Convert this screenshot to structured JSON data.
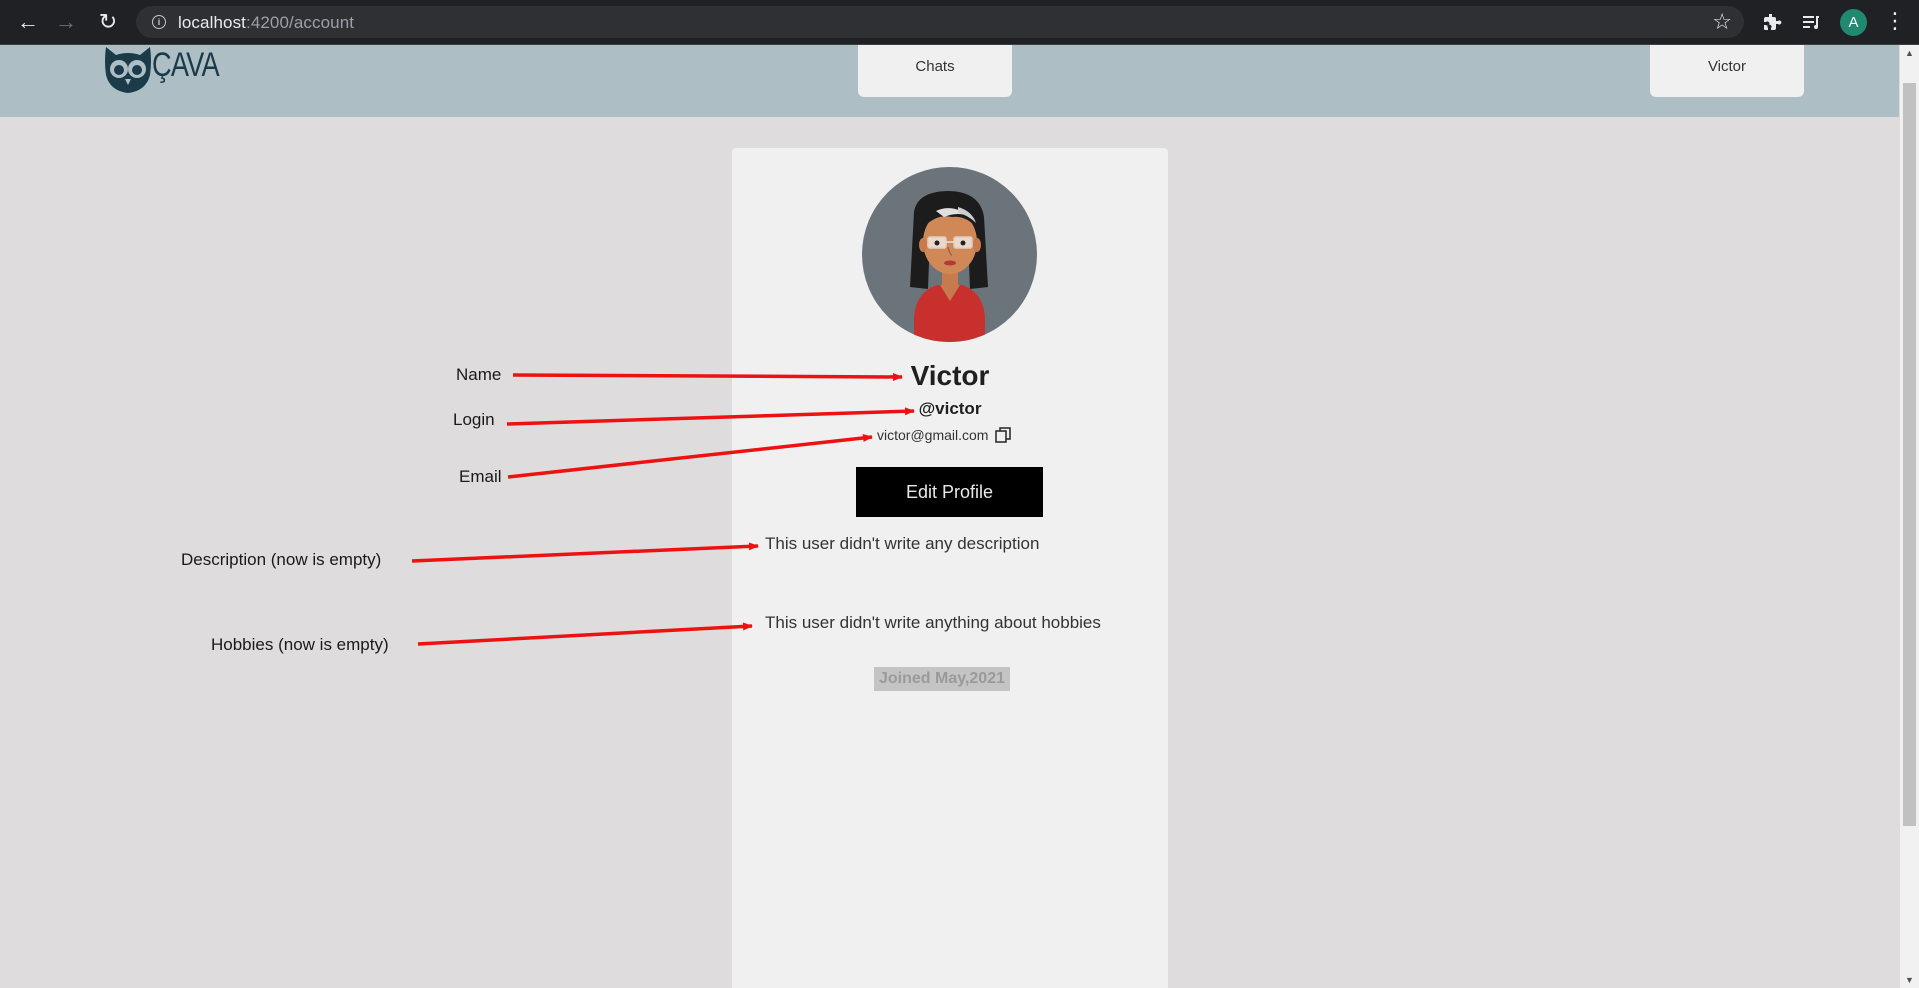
{
  "browser": {
    "url_host": "localhost",
    "url_path": ":4200/account",
    "profile_initial": "A",
    "icons": [
      "back-icon",
      "forward-icon",
      "reload-icon",
      "info-icon",
      "star-icon",
      "extensions-icon",
      "reading-list-icon",
      "menu-icon"
    ]
  },
  "header": {
    "logo_text": "ÇAVA",
    "chats_label": "Chats",
    "user_label": "Victor"
  },
  "profile": {
    "name": "Victor",
    "login": "@victor",
    "email": "victor@gmail.com",
    "edit_label": "Edit Profile",
    "description": "This user didn't write any description",
    "hobbies": "This user didn't write anything about hobbies",
    "joined": "Joined May,2021"
  },
  "annotations": {
    "name": "Name",
    "login": "Login",
    "email": "Email",
    "description": "Description (now is empty)",
    "hobbies": "Hobbies (now is empty)"
  },
  "colors": {
    "header_bg": "#aebec5",
    "page_bg": "#dedcdc",
    "card_bg": "#f0f0f0",
    "arrow": "#ee1111"
  }
}
